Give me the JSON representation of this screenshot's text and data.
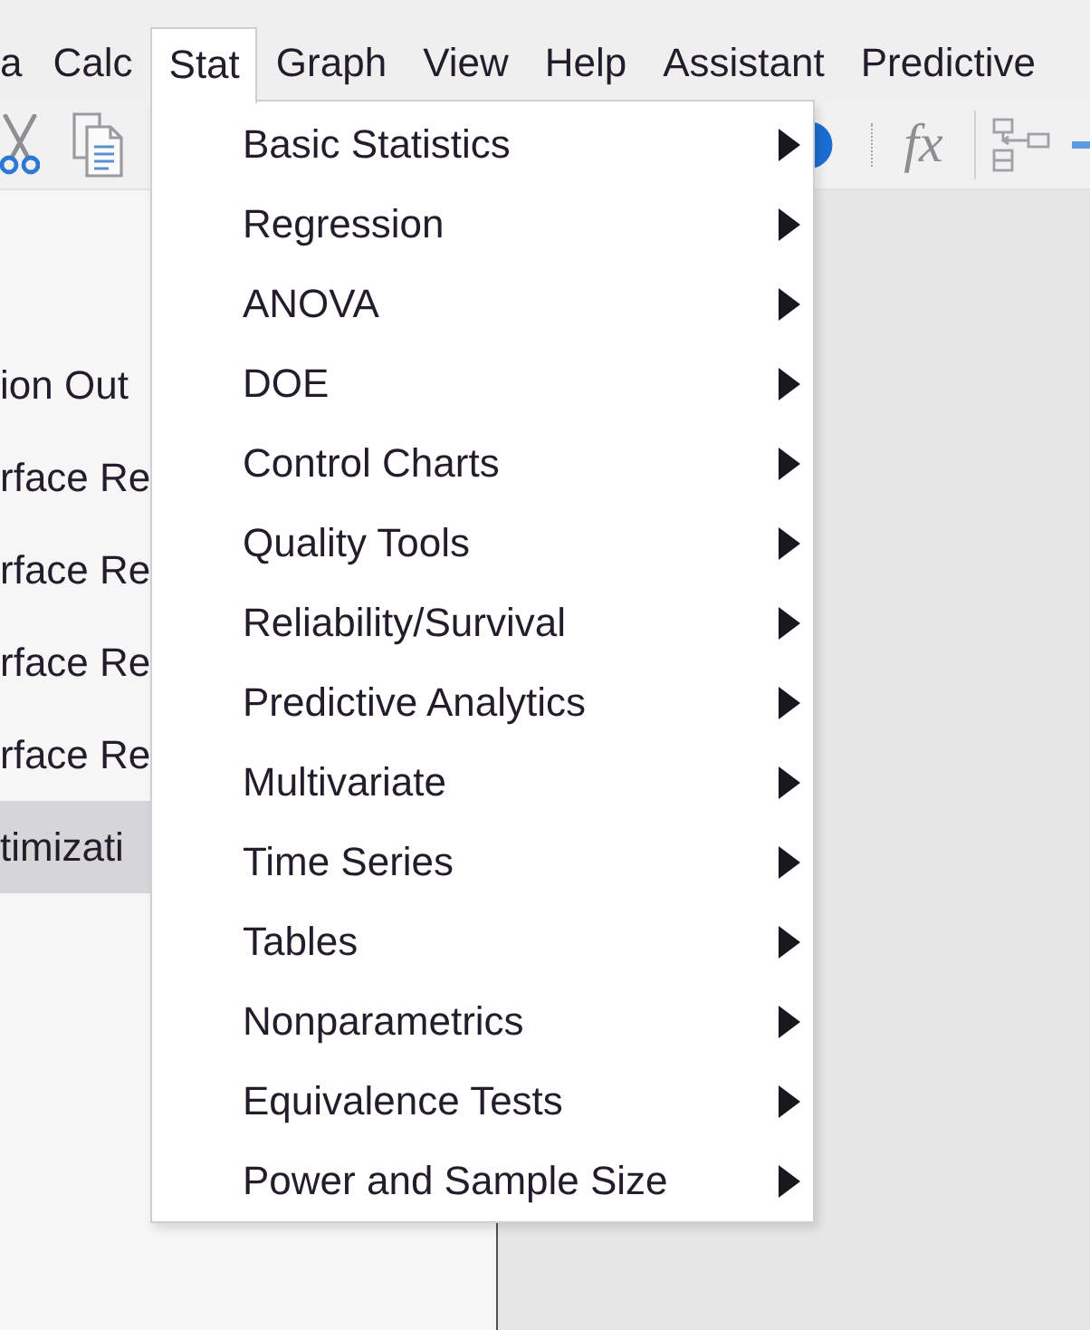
{
  "menu_bar": [
    {
      "label": "a",
      "selected": false
    },
    {
      "label": "Calc",
      "selected": false
    },
    {
      "label": "Stat",
      "selected": true
    },
    {
      "label": "Graph",
      "selected": false
    },
    {
      "label": "View",
      "selected": false
    },
    {
      "label": "Help",
      "selected": false
    },
    {
      "label": "Assistant",
      "selected": false
    },
    {
      "label": "Predictive",
      "selected": false
    }
  ],
  "toolbar": {
    "formula_label": "fx"
  },
  "navigator": {
    "items": [
      {
        "label": "ion Out",
        "selected": false
      },
      {
        "label": "rface Re",
        "selected": false
      },
      {
        "label": "rface Re",
        "selected": false
      },
      {
        "label": "rface Re",
        "selected": false
      },
      {
        "label": "rface Re",
        "selected": false
      },
      {
        "label": "timizati",
        "selected": true
      }
    ]
  },
  "stat_menu": {
    "items": [
      {
        "label": "Basic Statistics",
        "has_submenu": true
      },
      {
        "label": "Regression",
        "has_submenu": true
      },
      {
        "label": "ANOVA",
        "has_submenu": true
      },
      {
        "label": "DOE",
        "has_submenu": true
      },
      {
        "label": "Control Charts",
        "has_submenu": true
      },
      {
        "label": "Quality Tools",
        "has_submenu": true
      },
      {
        "label": "Reliability/Survival",
        "has_submenu": true
      },
      {
        "label": "Predictive Analytics",
        "has_submenu": true
      },
      {
        "label": "Multivariate",
        "has_submenu": true
      },
      {
        "label": "Time Series",
        "has_submenu": true
      },
      {
        "label": "Tables",
        "has_submenu": true
      },
      {
        "label": "Nonparametrics",
        "has_submenu": true
      },
      {
        "label": "Equivalence Tests",
        "has_submenu": true
      },
      {
        "label": "Power and Sample Size",
        "has_submenu": true
      }
    ]
  }
}
